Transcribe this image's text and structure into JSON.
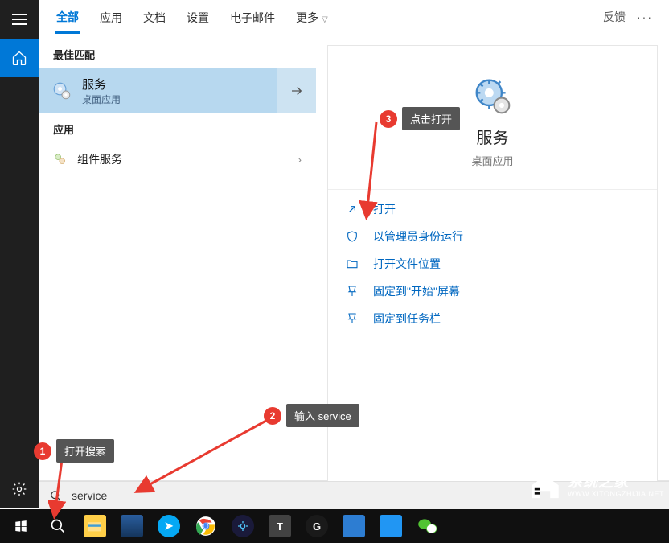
{
  "tabs": {
    "items": [
      "全部",
      "应用",
      "文档",
      "设置",
      "电子邮件"
    ],
    "more": "更多",
    "active_index": 0,
    "feedback": "反馈"
  },
  "sections": {
    "best_match": "最佳匹配",
    "apps": "应用"
  },
  "best": {
    "title": "服务",
    "subtitle": "桌面应用"
  },
  "app_items": [
    {
      "label": "组件服务"
    }
  ],
  "panel": {
    "title": "服务",
    "subtitle": "桌面应用",
    "actions": [
      {
        "icon": "open",
        "label": "打开"
      },
      {
        "icon": "admin",
        "label": "以管理员身份运行"
      },
      {
        "icon": "folder",
        "label": "打开文件位置"
      },
      {
        "icon": "pin-start",
        "label": "固定到\"开始\"屏幕"
      },
      {
        "icon": "pin-task",
        "label": "固定到任务栏"
      }
    ]
  },
  "search": {
    "value": "service"
  },
  "callouts": {
    "c1": {
      "num": "1",
      "label": "打开搜索"
    },
    "c2": {
      "num": "2",
      "label": "输入 service"
    },
    "c3": {
      "num": "3",
      "label": "点击打开"
    }
  },
  "watermark": {
    "title": "系统之家",
    "url": "WWW.XITONGZHIJIA.NET"
  }
}
